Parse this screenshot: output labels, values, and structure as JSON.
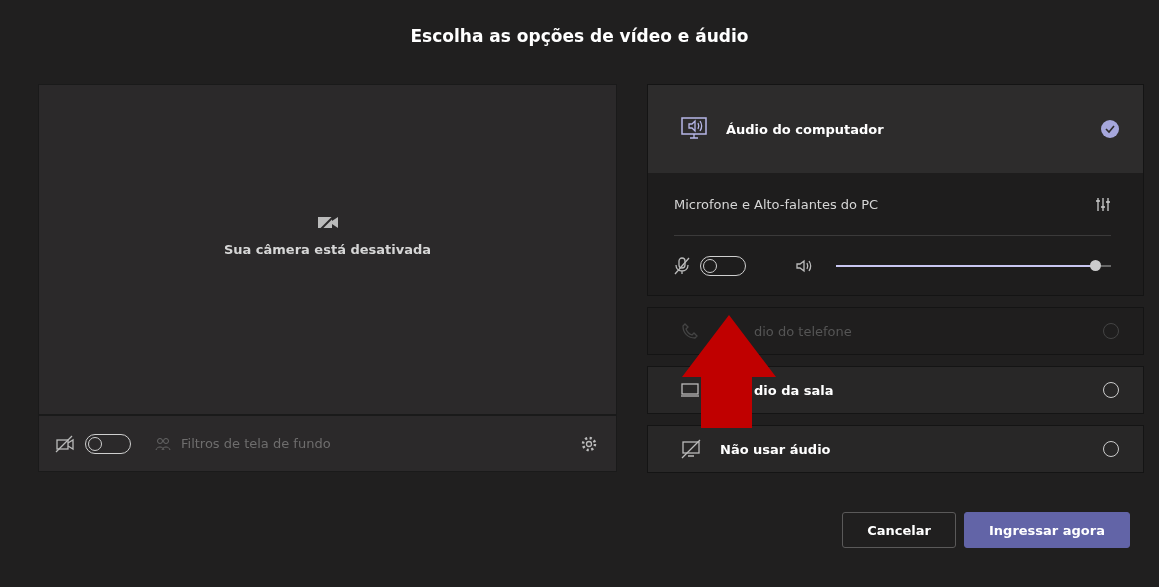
{
  "title": "Escolha as opções de vídeo e áudio",
  "camera": {
    "message": "Sua câmera está desativada",
    "on": false,
    "filter_label": "Filtros de tela de fundo"
  },
  "computer_audio": {
    "label": "Áudio do computador",
    "selected": true,
    "device": "Microfone e Alto-falantes do PC",
    "mic_on": false,
    "volume": {
      "level": 0.94
    }
  },
  "options": [
    {
      "kind": "phone",
      "label": "dio do telefone",
      "covered": true,
      "disabled": true,
      "selected": false
    },
    {
      "kind": "room",
      "label": "dio da sala",
      "covered": true,
      "disabled": false,
      "selected": false
    },
    {
      "kind": "none",
      "label": "Não usar áudio",
      "covered": false,
      "disabled": false,
      "selected": false
    }
  ],
  "buttons": [
    {
      "kind": "secondary",
      "label": "Cancelar"
    },
    {
      "kind": "primary",
      "label": "Ingressar agora"
    }
  ]
}
